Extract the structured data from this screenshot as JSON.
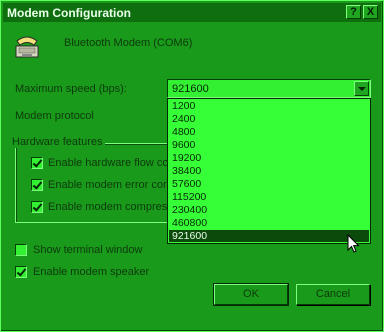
{
  "window": {
    "title": "Modem Configuration",
    "help_label": "?",
    "close_label": "X"
  },
  "device": {
    "name": "Bluetooth Modem (COM6)"
  },
  "speed": {
    "label": "Maximum speed (bps):",
    "value": "921600"
  },
  "protocol": {
    "label": "Modem protocol"
  },
  "hardware": {
    "legend": "Hardware features",
    "flow_label": "Enable hardware flow co",
    "error_label": "Enable modem error contr",
    "compress_label": "Enable modem compressi"
  },
  "options": {
    "terminal_label": "Show terminal window",
    "speaker_label": "Enable modem speaker"
  },
  "buttons": {
    "ok": "OK",
    "cancel": "Cancel"
  },
  "dropdown": {
    "items": [
      "1200",
      "2400",
      "4800",
      "9600",
      "19200",
      "38400",
      "57600",
      "115200",
      "230400",
      "460800",
      "921600"
    ],
    "selected": "921600"
  },
  "colors": {
    "window_bg": "#1a9a1a",
    "titlebar_bg": "#0f6f0f",
    "list_bg": "#37ff37",
    "selection_bg": "#0b4a0b"
  },
  "icons": [
    "telephone-modem-icon",
    "help-icon",
    "close-icon",
    "dropdown-arrow-icon",
    "mouse-cursor-icon"
  ]
}
